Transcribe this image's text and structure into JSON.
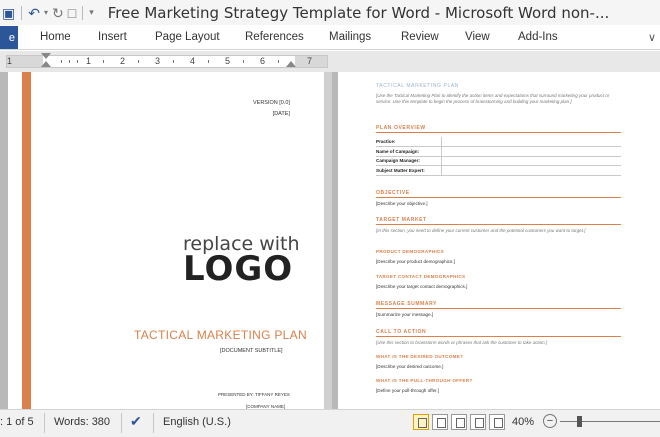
{
  "window": {
    "title": "Free Marketing Strategy Template for Word  -  Microsoft Word non-..."
  },
  "ribbon": {
    "file_tab": "e",
    "tabs": [
      "Home",
      "Insert",
      "Page Layout",
      "References",
      "Mailings",
      "Review",
      "View",
      "Add-Ins"
    ]
  },
  "ruler": {
    "numbers": [
      "1",
      "1",
      "2",
      "3",
      "4",
      "5",
      "6",
      "7"
    ]
  },
  "page1": {
    "version": "VERSION [0.0]",
    "date": "[DATE]",
    "logo_top": "replace with",
    "logo_main": "LOGO",
    "title": "TACTICAL MARKETING PLAN",
    "subtitle": "[DOCUMENT SUBTITLE]",
    "presented_by": "PRESENTED BY: TIFFANY REYES",
    "company": "[COMPANY NAME]"
  },
  "page2": {
    "heading": "TACTICAL MARKETING PLAN",
    "intro": "[Use the Tactical Marketing Plan to identify the action items and expectations that surround marketing your product or service. Use this template to begin the process of brainstorming and building your marketing plan.]",
    "plan_overview": {
      "heading": "PLAN OVERVIEW",
      "rows": [
        "Practice:",
        "Name of Campaign:",
        "Campaign Manager:",
        "Subject Matter Expert:"
      ]
    },
    "objective": {
      "heading": "OBJECTIVE",
      "text": "[Describe your objective.]"
    },
    "target_market": {
      "heading": "TARGET MARKET",
      "text": "[In this section, you need to define your current customer and the potential customers you want to target.]",
      "product_demographics": "PRODUCT DEMOGRAPHICS",
      "product_demographics_text": "[Describe your product demographics.]",
      "target_contact": "TARGET CONTACT DEMOGRAPHICS",
      "target_contact_text": "[Describe your target contact demographics.]"
    },
    "message_summary": {
      "heading": "MESSAGE SUMMARY",
      "text": "[Summarize your message.]"
    },
    "call_to_action": {
      "heading": "CALL TO ACTION",
      "text": "[Use this section to brainstorm words or phrases that ask the customer to take action.]",
      "desired_outcome": "WHAT IS THE DESIRED OUTCOME?",
      "desired_outcome_text": "[Describe your desired outcome.]",
      "pull_through": "WHAT IS THE PULL-THROUGH OFFER?",
      "pull_through_text": "[Define your pull-through offer.]"
    }
  },
  "status": {
    "page": ": 1 of 5",
    "words": "Words: 380",
    "language": "English (U.S.)",
    "zoom": "40%",
    "zoom_level_percent": 40
  },
  "colors": {
    "accent_orange": "#d9804b",
    "file_tab_blue": "#2b579a"
  }
}
